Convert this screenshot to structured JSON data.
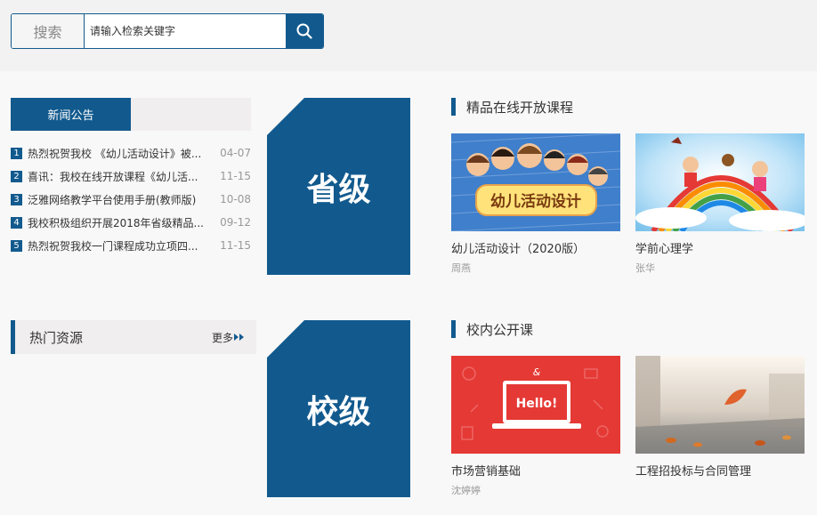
{
  "search": {
    "label": "搜索",
    "placeholder": "请输入检索关键字"
  },
  "news": {
    "tab_label": "新闻公告",
    "items": [
      {
        "num": "1",
        "title": "热烈祝贺我校 《幼儿活动设计》被...",
        "date": "04-07"
      },
      {
        "num": "2",
        "title": "喜讯：我校在线开放课程《幼儿活...",
        "date": "11-15"
      },
      {
        "num": "3",
        "title": "泛雅网络教学平台使用手册(教师版)",
        "date": "10-08"
      },
      {
        "num": "4",
        "title": "我校积极组织开展2018年省级精品...",
        "date": "09-12"
      },
      {
        "num": "5",
        "title": "热烈祝贺我校一门课程成功立项四...",
        "date": "11-15"
      }
    ]
  },
  "hot": {
    "title": "热门资源",
    "more_label": "更多"
  },
  "levels": {
    "provincial": "省级",
    "school": "校级"
  },
  "sections": {
    "provincial_title": "精品在线开放课程",
    "school_title": "校内公开课"
  },
  "courses": {
    "c1": {
      "name": "幼儿活动设计（2020版）",
      "teacher": "周燕",
      "thumb_text": "幼儿活动设计"
    },
    "c2": {
      "name": "学前心理学",
      "teacher": "张华"
    },
    "c3": {
      "name": "市场营销基础",
      "teacher": "沈婷婷",
      "thumb_text": "Hello!"
    },
    "c4": {
      "name": "工程招投标与合同管理",
      "teacher": ""
    }
  },
  "colors": {
    "primary": "#125a8e",
    "panel_bg": "#f0eeee",
    "page_bg": "#f8f8f8"
  }
}
